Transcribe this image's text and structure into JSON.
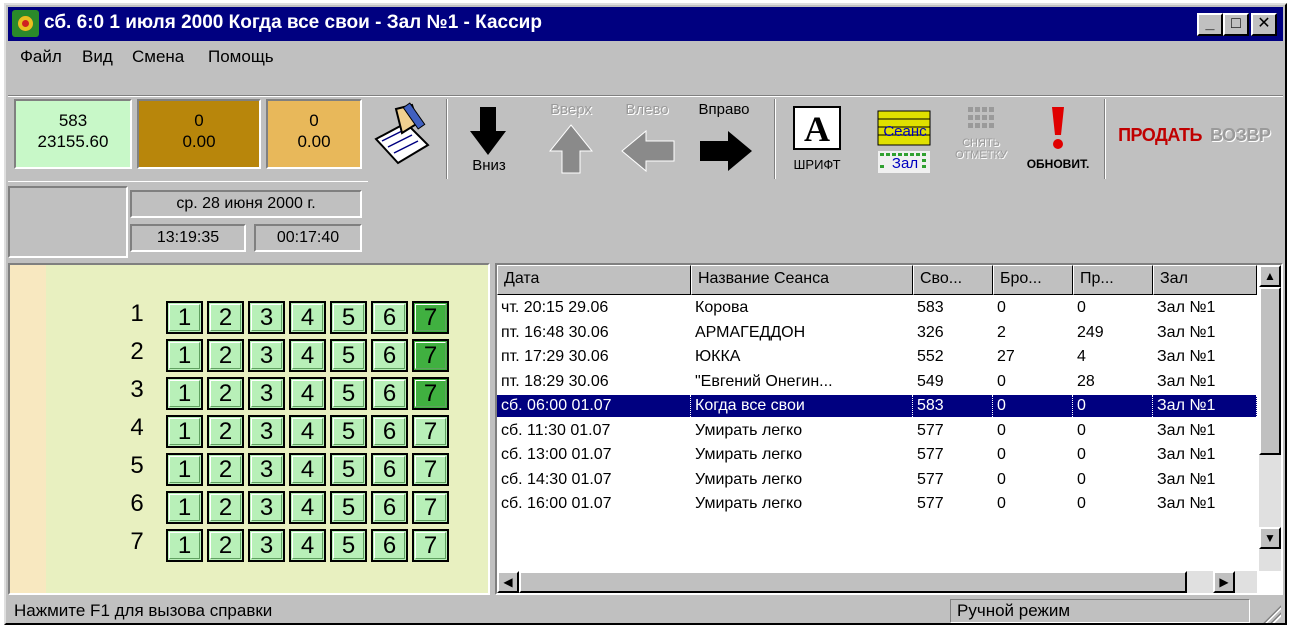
{
  "titlebar": {
    "title": "сб. 6:0 1 июля 2000  Когда все свои - Зал №1 - Кассир",
    "icon": "app-icon",
    "minimize": "_",
    "maximize": "□",
    "close": "✕"
  },
  "menu": [
    "Файл",
    "Вид",
    "Смена",
    "Помощь"
  ],
  "counters": [
    {
      "count": "583",
      "amount": "23155.60",
      "color": "#c8f8c8"
    },
    {
      "count": "0",
      "amount": "0.00",
      "color": "#b8860b"
    },
    {
      "count": "0",
      "amount": "0.00",
      "color": "#e8b85a"
    }
  ],
  "toolbar": {
    "down": "Вниз",
    "up": "Вверх",
    "left": "Влево",
    "right": "Вправо",
    "font": "ШРИФТ",
    "session_top": "Сеанс",
    "session_bottom": "Зал",
    "unmark_1": "СНЯТЬ",
    "unmark_2": "ОТМЕТКУ",
    "refresh": "ОБНОВИТ.",
    "sell": "ПРОДАТЬ",
    "return": "ВОЗВР"
  },
  "datepanel": {
    "date": "ср. 28 июня 2000 г.",
    "time": "13:19:35",
    "elapsed": "00:17:40"
  },
  "seats": {
    "rows": [
      "1",
      "2",
      "3",
      "4",
      "5",
      "6",
      "7"
    ],
    "seat_labels": [
      "1",
      "2",
      "3",
      "4",
      "5",
      "6",
      "7"
    ]
  },
  "sessions": {
    "columns": [
      "Дата",
      "Название Сеанса",
      "Сво...",
      "Бро...",
      "Пр...",
      "Зал"
    ],
    "rows": [
      [
        "чт. 20:15 29.06",
        "Корова",
        "583",
        "0",
        "0",
        "Зал №1"
      ],
      [
        "пт. 16:48 30.06",
        "АРМАГЕДДОН",
        "326",
        "2",
        "249",
        "Зал №1"
      ],
      [
        "пт. 17:29 30.06",
        "ЮККА",
        "552",
        "27",
        "4",
        "Зал №1"
      ],
      [
        "пт. 18:29 30.06",
        "\"Евгений Онегин...",
        "549",
        "0",
        "28",
        "Зал №1"
      ],
      [
        "сб. 06:00 01.07",
        "Когда все свои",
        "583",
        "0",
        "0",
        "Зал №1"
      ],
      [
        "сб. 11:30 01.07",
        "Умирать легко",
        "577",
        "0",
        "0",
        "Зал №1"
      ],
      [
        "сб. 13:00 01.07",
        "Умирать легко",
        "577",
        "0",
        "0",
        "Зал №1"
      ],
      [
        "сб. 14:30 01.07",
        "Умирать легко",
        "577",
        "0",
        "0",
        "Зал №1"
      ],
      [
        "сб. 16:00 01.07",
        "Умирать легко",
        "577",
        "0",
        "0",
        "Зал №1"
      ]
    ],
    "selected_index": 4
  },
  "statusbar": {
    "hint": "Нажмите  F1 для вызова справки",
    "mode": "Ручной режим"
  }
}
